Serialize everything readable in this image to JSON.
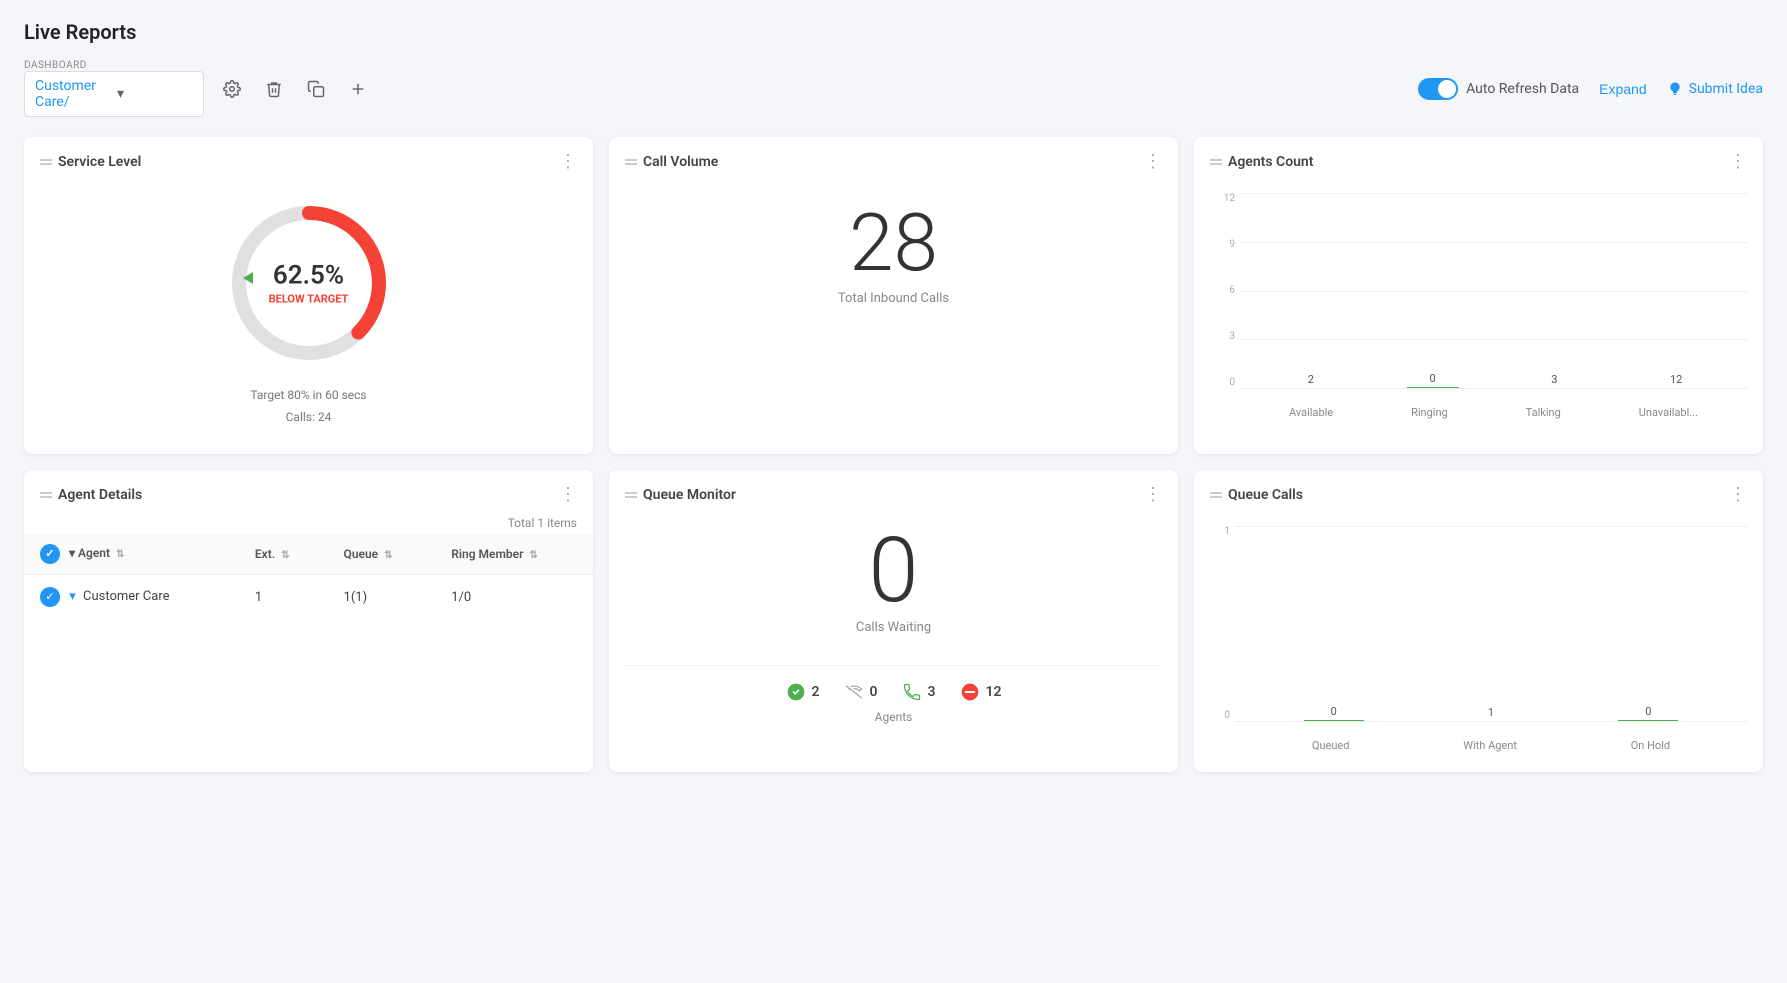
{
  "page": {
    "title": "Live Reports"
  },
  "toolbar": {
    "dashboard_label": "DASHBOARD",
    "dashboard_value": "Customer Care/",
    "auto_refresh_label": "Auto Refresh Data",
    "expand_label": "Expand",
    "submit_idea_label": "Submit Idea"
  },
  "service_level": {
    "title": "Service Level",
    "percent": "62.5%",
    "status": "BELOW TARGET",
    "info_line1": "Target 80% in 60 secs",
    "info_line2": "Calls: 24",
    "donut_percent": 62.5,
    "donut_color": "#f44336",
    "donut_bg": "#e0e0e0"
  },
  "call_volume": {
    "title": "Call Volume",
    "number": "28",
    "label": "Total Inbound Calls"
  },
  "agents_count": {
    "title": "Agents Count",
    "bars": [
      {
        "label": "Available",
        "value": 2,
        "color": "#4CAF50"
      },
      {
        "label": "Ringing",
        "value": 0,
        "color": "#4CAF50"
      },
      {
        "label": "Talking",
        "value": 3,
        "color": "#4CAF50"
      },
      {
        "label": "Unavailabl...",
        "value": 12,
        "color": "#f44336"
      }
    ],
    "y_ticks": [
      "12",
      "9",
      "6",
      "3",
      "0"
    ]
  },
  "agent_details": {
    "title": "Agent Details",
    "total_items": "Total 1 items",
    "columns": [
      {
        "label": "Agent",
        "sortable": true
      },
      {
        "label": "Ext.",
        "sortable": true
      },
      {
        "label": "Queue",
        "sortable": true
      },
      {
        "label": "Ring Member",
        "sortable": true
      }
    ],
    "rows": [
      {
        "agent": "Customer Care",
        "ext": "1",
        "queue": "1(1)",
        "ring_member": "1/0"
      }
    ]
  },
  "queue_monitor": {
    "title": "Queue Monitor",
    "calls_waiting_number": "0",
    "calls_waiting_label": "Calls Waiting",
    "stats": [
      {
        "icon": "check-circle",
        "value": "2",
        "color": "#4CAF50"
      },
      {
        "icon": "missed-call",
        "value": "0",
        "color": "#888"
      },
      {
        "icon": "active-call",
        "value": "3",
        "color": "#4CAF50"
      },
      {
        "icon": "blocked",
        "value": "12",
        "color": "#f44336"
      }
    ],
    "agents_label": "Agents"
  },
  "queue_calls": {
    "title": "Queue Calls",
    "bars": [
      {
        "label": "Queued",
        "value": 0,
        "color": "#4CAF50"
      },
      {
        "label": "With Agent",
        "value": 1,
        "color": "#4CAF50"
      },
      {
        "label": "On Hold",
        "value": 0,
        "color": "#4CAF50"
      }
    ],
    "y_ticks": [
      "1",
      "0"
    ]
  }
}
